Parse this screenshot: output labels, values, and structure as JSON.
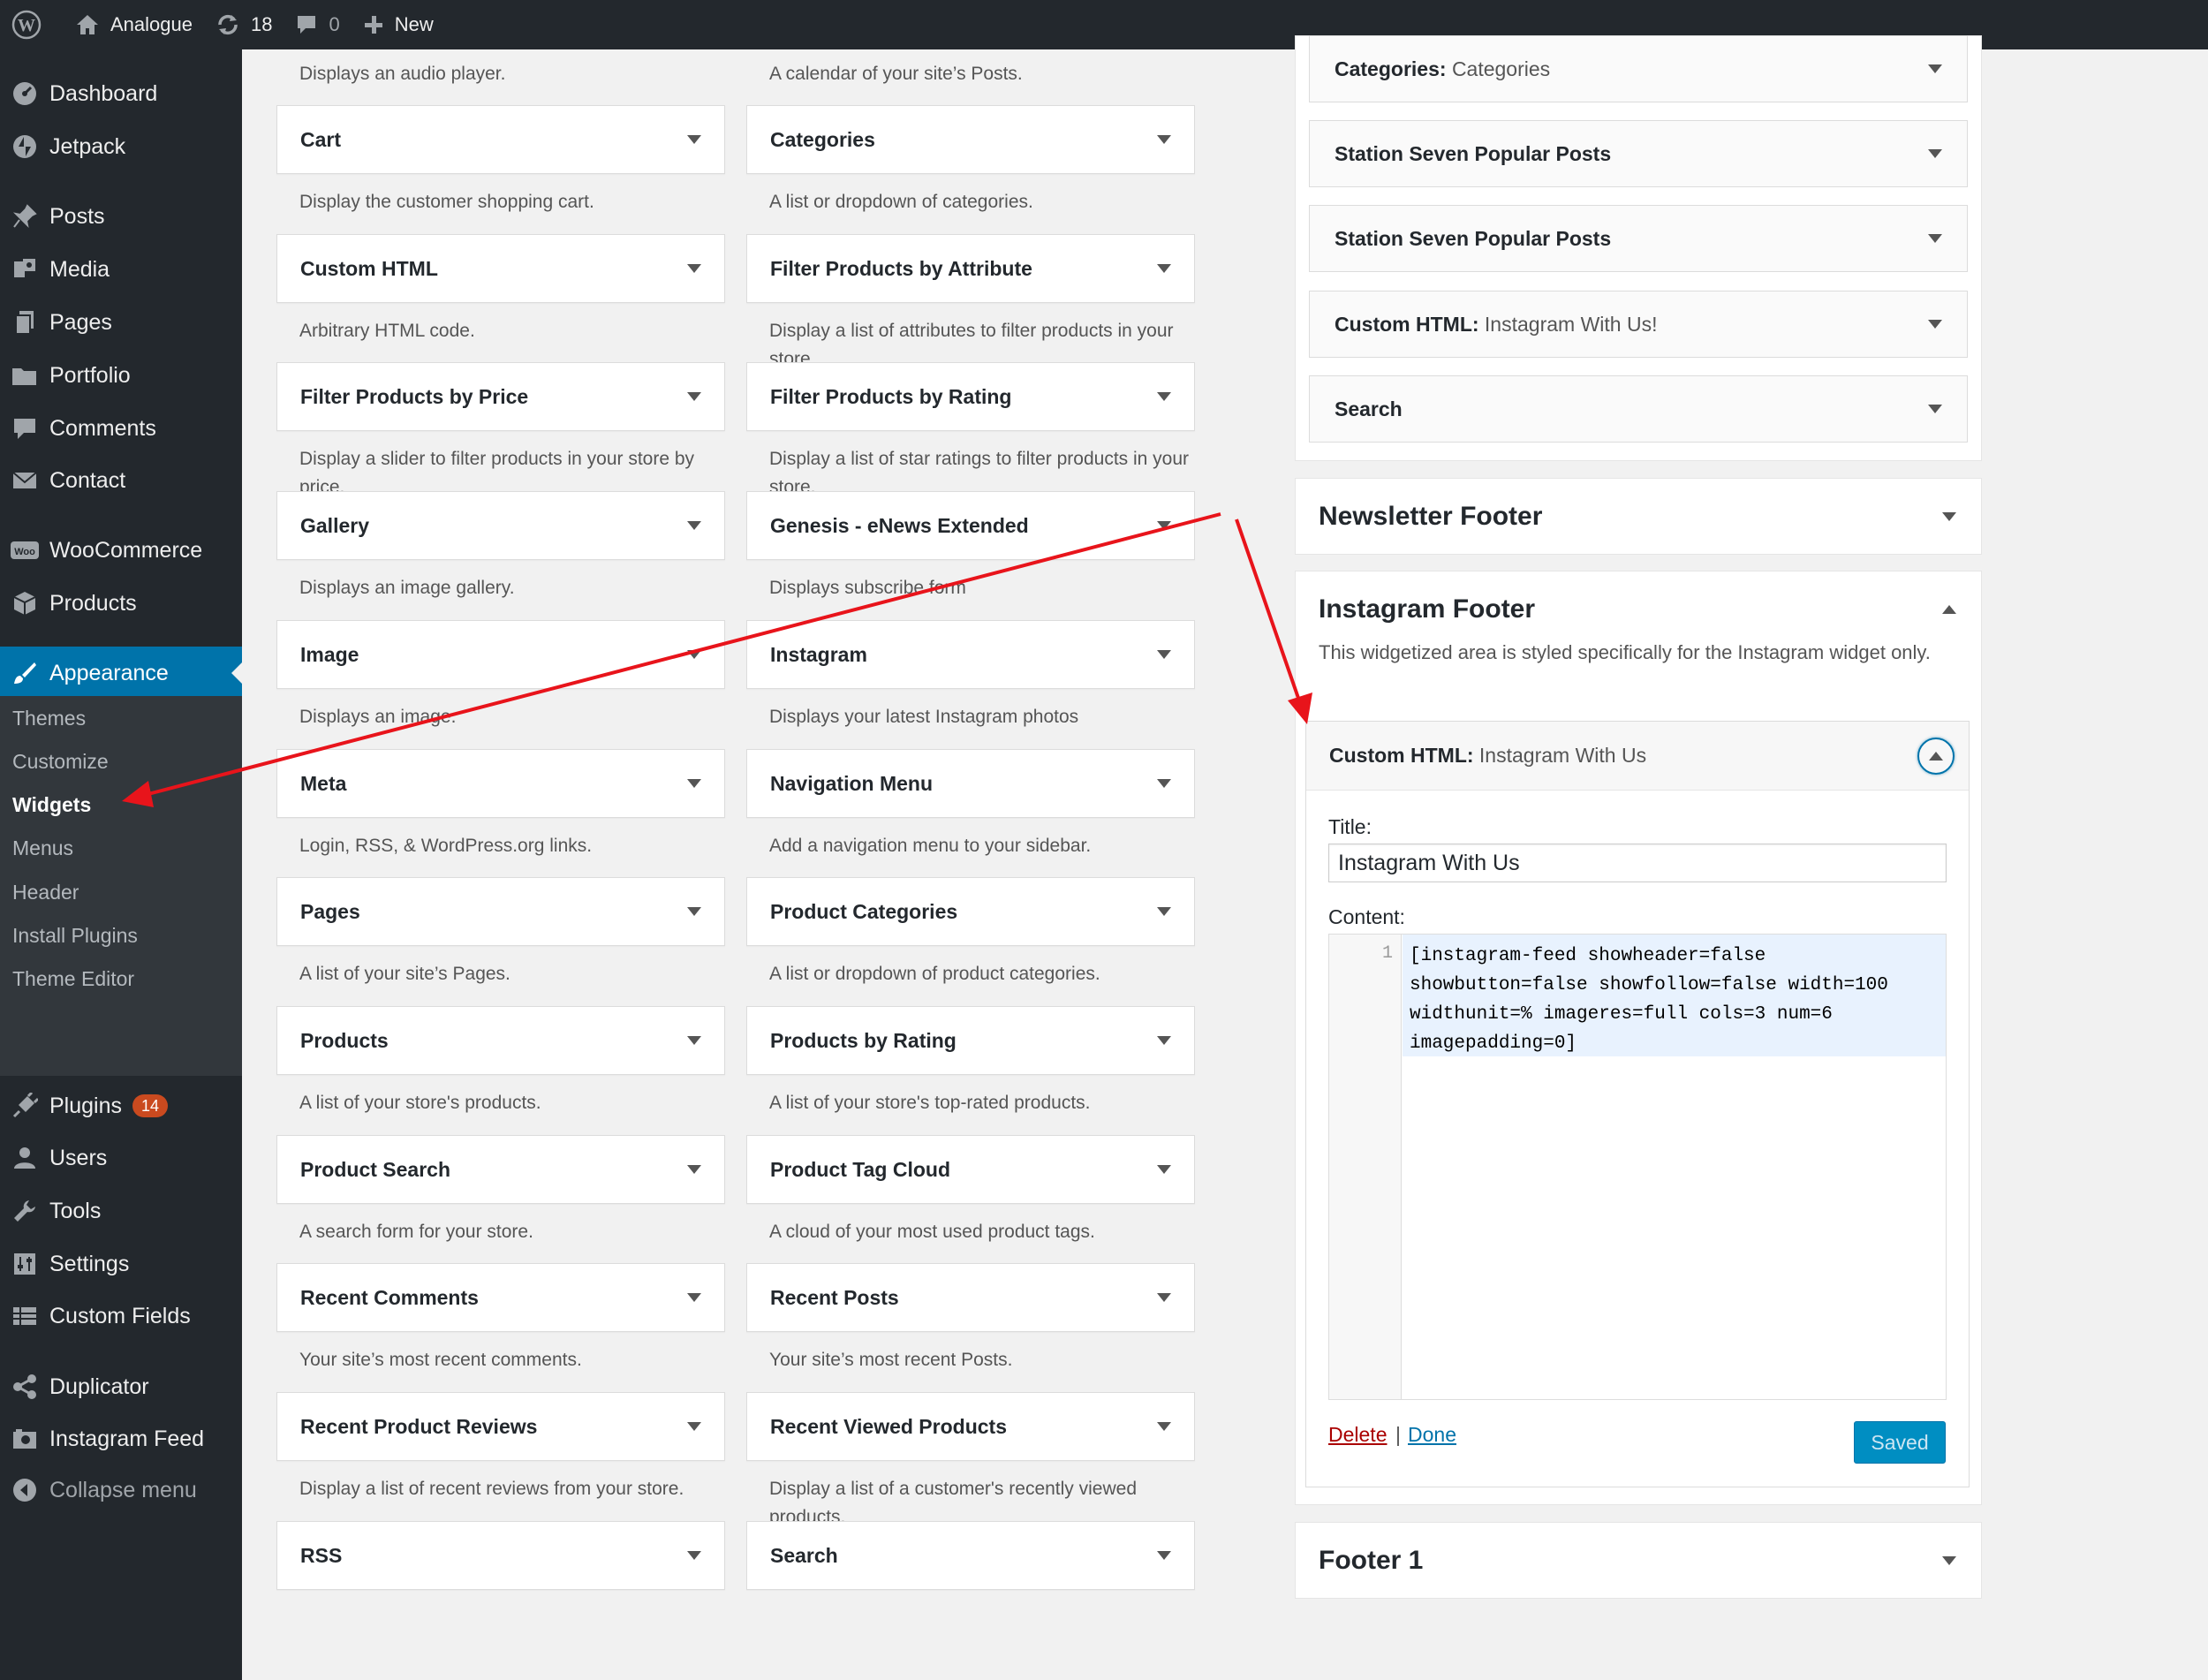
{
  "admin_bar": {
    "site_name": "Analogue",
    "updates_count": "18",
    "comments_count": "0",
    "new_label": "New"
  },
  "sidebar": {
    "items": [
      {
        "label": "Dashboard",
        "icon": "dashboard-icon"
      },
      {
        "label": "Jetpack",
        "icon": "jetpack-icon"
      },
      {
        "label": "Posts",
        "icon": "pin-icon"
      },
      {
        "label": "Media",
        "icon": "media-icon"
      },
      {
        "label": "Pages",
        "icon": "pages-icon"
      },
      {
        "label": "Portfolio",
        "icon": "folder-icon"
      },
      {
        "label": "Comments",
        "icon": "comment-icon"
      },
      {
        "label": "Contact",
        "icon": "mail-icon"
      },
      {
        "label": "WooCommerce",
        "icon": "woo-icon"
      },
      {
        "label": "Products",
        "icon": "box-icon"
      },
      {
        "label": "Appearance",
        "icon": "brush-icon"
      },
      {
        "label": "Plugins",
        "icon": "plug-icon",
        "badge": "14"
      },
      {
        "label": "Users",
        "icon": "user-icon"
      },
      {
        "label": "Tools",
        "icon": "wrench-icon"
      },
      {
        "label": "Settings",
        "icon": "sliders-icon"
      },
      {
        "label": "Custom Fields",
        "icon": "grid-icon"
      },
      {
        "label": "Duplicator",
        "icon": "share-icon"
      },
      {
        "label": "Instagram Feed",
        "icon": "camera-icon"
      },
      {
        "label": "Collapse menu",
        "icon": "collapse-icon"
      }
    ],
    "submenu": [
      "Themes",
      "Customize",
      "Widgets",
      "Menus",
      "Header",
      "Install Plugins",
      "Theme Editor"
    ]
  },
  "top_descs": {
    "left": "Displays an audio player.",
    "right": "A calendar of your site’s Posts."
  },
  "widgets": [
    {
      "title": "Cart",
      "desc": "Display the customer shopping cart."
    },
    {
      "title": "Categories",
      "desc": "A list or dropdown of categories."
    },
    {
      "title": "Custom HTML",
      "desc": "Arbitrary HTML code."
    },
    {
      "title": "Filter Products by Attribute",
      "desc": "Display a list of attributes to filter products in your store."
    },
    {
      "title": "Filter Products by Price",
      "desc": "Display a slider to filter products in your store by price."
    },
    {
      "title": "Filter Products by Rating",
      "desc": "Display a list of star ratings to filter products in your store."
    },
    {
      "title": "Gallery",
      "desc": "Displays an image gallery."
    },
    {
      "title": "Genesis - eNews Extended",
      "desc": "Displays subscribe form"
    },
    {
      "title": "Image",
      "desc": "Displays an image."
    },
    {
      "title": "Instagram",
      "desc": "Displays your latest Instagram photos"
    },
    {
      "title": "Meta",
      "desc": "Login, RSS, & WordPress.org links."
    },
    {
      "title": "Navigation Menu",
      "desc": "Add a navigation menu to your sidebar."
    },
    {
      "title": "Pages",
      "desc": "A list of your site’s Pages."
    },
    {
      "title": "Product Categories",
      "desc": "A list or dropdown of product categories."
    },
    {
      "title": "Products",
      "desc": "A list of your store's products."
    },
    {
      "title": "Products by Rating",
      "desc": "A list of your store's top-rated products."
    },
    {
      "title": "Product Search",
      "desc": "A search form for your store."
    },
    {
      "title": "Product Tag Cloud",
      "desc": "A cloud of your most used product tags."
    },
    {
      "title": "Recent Comments",
      "desc": "Your site’s most recent comments."
    },
    {
      "title": "Recent Posts",
      "desc": "Your site’s most recent Posts."
    },
    {
      "title": "Recent Product Reviews",
      "desc": "Display a list of recent reviews from your store."
    },
    {
      "title": "Recent Viewed Products",
      "desc": "Display a list of a customer's recently viewed products."
    },
    {
      "title": "RSS",
      "desc": ""
    },
    {
      "title": "Search",
      "desc": ""
    }
  ],
  "sidebar_area": {
    "widgets": [
      {
        "title": "Categories:",
        "subtitle": "Categories"
      },
      {
        "title": "Station Seven Popular Posts",
        "subtitle": ""
      },
      {
        "title": "Station Seven Popular Posts",
        "subtitle": ""
      },
      {
        "title": "Custom HTML:",
        "subtitle": "Instagram With Us!"
      },
      {
        "title": "Search",
        "subtitle": ""
      }
    ]
  },
  "newsletter_footer": {
    "title": "Newsletter Footer"
  },
  "instagram_footer": {
    "title": "Instagram Footer",
    "description": "This widgetized area is styled specifically for the Instagram widget only.",
    "widget": {
      "title": "Custom HTML:",
      "subtitle": "Instagram With Us",
      "title_label": "Title:",
      "title_value": "Instagram With Us",
      "content_label": "Content:",
      "line_number": "1",
      "code": "[instagram-feed showheader=false\nshowbutton=false showfollow=false width=100\nwidthunit=% imageres=full cols=3 num=6\nimagepadding=0]",
      "delete_label": "Delete",
      "separator": "|",
      "done_label": "Done",
      "saved_label": "Saved"
    }
  },
  "footer1": {
    "title": "Footer 1"
  },
  "colors": {
    "admin_bar": "#23282d",
    "accent": "#0073aa",
    "annotation_arrow": "#e8141b",
    "badge": "#ca4a1f"
  }
}
